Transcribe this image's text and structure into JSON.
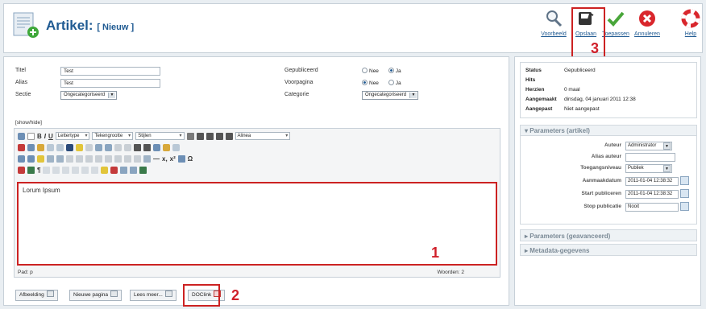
{
  "header": {
    "title": "Artikel:",
    "subtitle": "[ Nieuw ]"
  },
  "toolbar": {
    "buttons": [
      {
        "label": "Voorbeeld",
        "icon": "preview-icon"
      },
      {
        "label": "Opslaan",
        "icon": "save-icon"
      },
      {
        "label": "Toepassen",
        "icon": "apply-icon"
      },
      {
        "label": "Annuleren",
        "icon": "cancel-icon"
      },
      {
        "label": "Help",
        "icon": "help-icon"
      }
    ]
  },
  "callouts": [
    "1",
    "2",
    "3"
  ],
  "form": {
    "titel_label": "Titel",
    "titel_value": "Test",
    "alias_label": "Alias",
    "alias_value": "Test",
    "sectie_label": "Sectie",
    "sectie_value": "Ongecategoriseerd",
    "gepubliceerd_label": "Gepubliceerd",
    "voorpagina_label": "Voorpagina",
    "categorie_label": "Categorie",
    "categorie_value": "Ongecategoriseerd",
    "radio_nee": "Nee",
    "radio_ja": "Ja",
    "gepubliceerd_selected": "Ja",
    "voorpagina_selected": "Nee"
  },
  "editor": {
    "showhide": "[show/hide]",
    "font_select": "Lettertype",
    "size_select": "Tekengrootte",
    "style_select": "Stijlen",
    "format_select": "Alinea",
    "content": "Lorum Ipsum",
    "path": "Pad: p",
    "words": "Woorden: 2"
  },
  "bottom_buttons": [
    "Afbeelding",
    "Nieuwe pagina",
    "Lees meer...",
    "DOClink"
  ],
  "info": {
    "rows": [
      {
        "label": "Status",
        "value": "Gepubliceerd"
      },
      {
        "label": "Hits",
        "value": ""
      },
      {
        "label": "Herzien",
        "value": "0 maal"
      },
      {
        "label": "Aangemaakt",
        "value": "dinsdag, 04 januari 2011 12:38"
      },
      {
        "label": "Aangepast",
        "value": "Niet aangepast"
      }
    ]
  },
  "params": {
    "title": "Parameters (artikel)",
    "auteur_label": "Auteur",
    "auteur_value": "Administrator",
    "alias_auteur_label": "Alias auteur",
    "toegang_label": "Toegangsniveau",
    "toegang_value": "Publiek",
    "aanmaak_label": "Aanmaakdatum",
    "aanmaak_value": "2011-01-04 12:38:32",
    "start_label": "Start publiceren",
    "start_value": "2011-01-04 12:38:32",
    "stop_label": "Stop publicatie",
    "stop_value": "Nooit"
  },
  "collapsed_panels": [
    "Parameters (geavanceerd)",
    "Metadata-gegevens"
  ]
}
